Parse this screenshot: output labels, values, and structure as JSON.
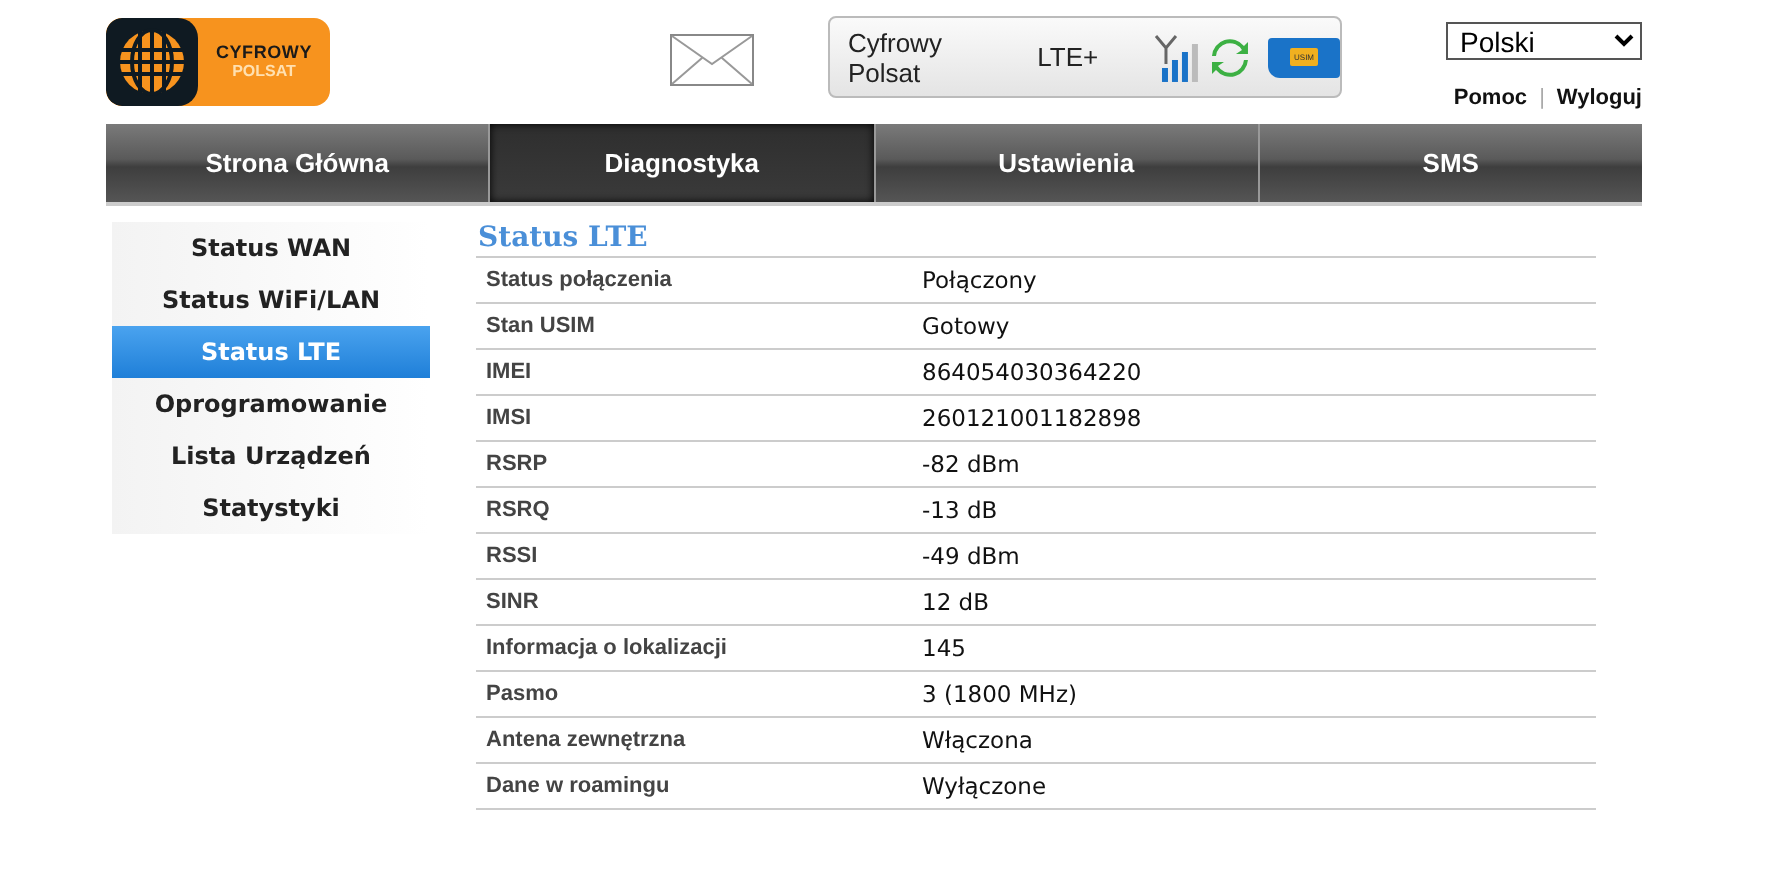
{
  "logo": {
    "line_1": "CYFROWY",
    "line_2": "POLSAT"
  },
  "status_panel": {
    "operator": "Cyfrowy Polsat",
    "network": "LTE+",
    "sim_label": "USIM"
  },
  "language": {
    "value": "Polski"
  },
  "links": [
    "Pomoc",
    "Wyloguj"
  ],
  "link_separator": "|",
  "tabs": [
    {
      "label": "Strona Główna",
      "selected": false
    },
    {
      "label": "Diagnostyka",
      "selected": true
    },
    {
      "label": "Ustawienia",
      "selected": false
    },
    {
      "label": "SMS",
      "selected": false
    }
  ],
  "sidebar": {
    "items": [
      {
        "label": "Status WAN",
        "selected": false
      },
      {
        "label": "Status WiFi/LAN",
        "selected": false
      },
      {
        "label": "Status LTE",
        "selected": true
      },
      {
        "label": "Oprogramowanie",
        "selected": false
      },
      {
        "label": "Lista Urządzeń",
        "selected": false
      },
      {
        "label": "Statystyki",
        "selected": false
      }
    ]
  },
  "section": {
    "title": "Status LTE",
    "rows": [
      {
        "label": "Status połączenia",
        "value": "Połączony"
      },
      {
        "label": "Stan USIM",
        "value": "Gotowy"
      },
      {
        "label": "IMEI",
        "value": "864054030364220"
      },
      {
        "label": "IMSI",
        "value": "260121001182898"
      },
      {
        "label": "RSRP",
        "value": "-82 dBm"
      },
      {
        "label": "RSRQ",
        "value": "-13 dB"
      },
      {
        "label": "RSSI",
        "value": "-49 dBm"
      },
      {
        "label": "SINR",
        "value": "12 dB"
      },
      {
        "label": "Informacja o lokalizacji",
        "value": "145"
      },
      {
        "label": "Pasmo",
        "value": "3 (1800 MHz)"
      },
      {
        "label": "Antena zewnętrzna",
        "value": "Włączona"
      },
      {
        "label": "Dane w roamingu",
        "value": "Wyłączone"
      }
    ]
  }
}
